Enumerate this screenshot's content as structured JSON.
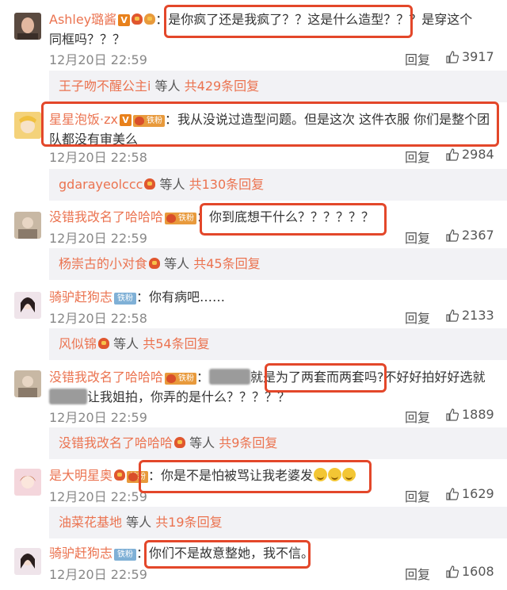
{
  "comments": [
    {
      "user": "Ashley璐酱",
      "time": "12月20日 22:59",
      "reply": "回复",
      "likes": "3917",
      "text": "是你疯了还是我疯了？？这是什么造型？？？是穿这个同框吗？？？",
      "text_a": "是你疯了还是我疯了？？这是什么造型？？",
      "text_b": "？是穿这个",
      "text_c": "同框吗？？？"
    },
    {
      "user": "星星泡饭·zx",
      "fan_label": "铁粉",
      "time": "12月20日 22:58",
      "reply": "回复",
      "likes": "2984",
      "text_a": "：我从没说过造型问题。但是这次 这件衣服 你们是整个团",
      "text_b": "队都没有审美么"
    },
    {
      "user": "没错我改名了哈哈哈",
      "fan_label": "铁粉",
      "time": "12月20日 22:59",
      "reply": "回复",
      "likes": "2367",
      "text": "你到底想干什么？？？？？？"
    },
    {
      "user": "骑驴赶狗志",
      "fan_label": "铁粉",
      "time": "12月20日 22:58",
      "reply": "回复",
      "likes": "2133",
      "text": "：你有病吧……"
    },
    {
      "user": "没错我改名了哈哈哈",
      "fan_label": "铁粉",
      "time": "12月20日 22:59",
      "reply": "回复",
      "likes": "1889",
      "text_a": "就是为了两套而两套吗?",
      "text_b": "不好好拍好好选就",
      "text_c": "让我姐拍，你弄的是什么？？？？？"
    },
    {
      "user": "是大明星奥",
      "fan_label": "铁粉",
      "time": "12月20日 22:59",
      "reply": "回复",
      "likes": "1629",
      "text": "：你是不是怕被骂让我老婆发"
    },
    {
      "user": "骑驴赶狗志",
      "fan_label": "铁粉",
      "time": "12月20日 22:59",
      "reply": "回复",
      "likes": "1608",
      "text": "你们不是故意整她，我不信。"
    }
  ],
  "threads": [
    {
      "name": "王子吻不醒公主i",
      "mid": " 等人 ",
      "count": "共429条回复"
    },
    {
      "name": "gdarayeolccc",
      "mid": " 等人 ",
      "count": "共130条回复"
    },
    {
      "name": "杨崇古的小对食",
      "mid": " 等人 ",
      "count": "共45条回复"
    },
    {
      "name": "风似锦",
      "mid": " 等人 ",
      "count": "共54条回复"
    },
    {
      "name": "没错我改名了哈哈哈",
      "mid": " 等人 ",
      "count": "共9条回复"
    },
    {
      "name": "油菜花基地",
      "mid": " 等人 ",
      "count": "共19条回复"
    }
  ],
  "colors": {
    "username": "#eb7350",
    "highlight": "#e3472a",
    "thread_bg": "#f2f2f5",
    "time": "#888888"
  },
  "icons": {
    "like": "thumbs-up-icon",
    "verified": "v-badge-icon",
    "fan": "fan-badge-icon"
  }
}
